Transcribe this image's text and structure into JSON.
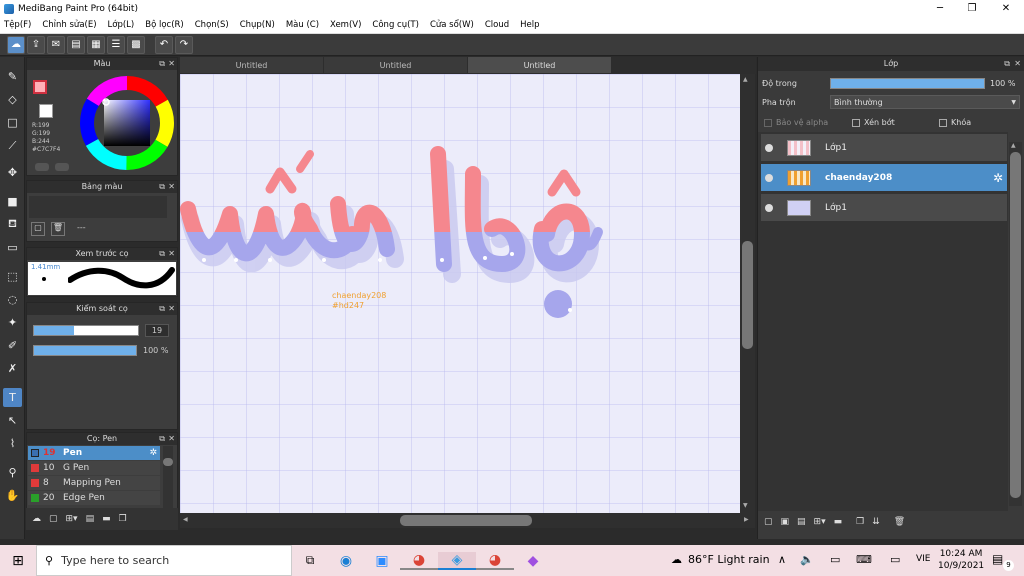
{
  "window": {
    "title": "MediBang Paint Pro (64bit)"
  },
  "menu": [
    "Tệp(F)",
    "Chỉnh sửa(E)",
    "Lớp(L)",
    "Bộ lọc(R)",
    "Chọn(S)",
    "Chụp(N)",
    "Màu (C)",
    "Xem(V)",
    "Công cụ(T)",
    "Cửa sổ(W)",
    "Cloud",
    "Help"
  ],
  "color_panel": {
    "title": "Màu",
    "r": "R:199",
    "g": "G:199",
    "b": "B:244",
    "hex": "#C7C7F4",
    "primary": "#ffb0b8",
    "secondary": "#ffffff"
  },
  "swatch_panel": {
    "title": "Bảng màu",
    "placeholder": "---"
  },
  "brush_preview": {
    "title": "Xem trước cọ",
    "size": "1.41mm"
  },
  "brush_control": {
    "title": "Kiểm soát cọ",
    "size_value": "19",
    "opacity_value": "100 %"
  },
  "brush_list": {
    "title": "Cọ: Pen",
    "items": [
      {
        "size": "19",
        "name": "Pen",
        "color": "#3a6fb0"
      },
      {
        "size": "10",
        "name": "G Pen",
        "color": "#e03a3a"
      },
      {
        "size": "8",
        "name": "Mapping Pen",
        "color": "#e03a3a"
      },
      {
        "size": "20",
        "name": "Edge Pen",
        "color": "#2aa02a"
      }
    ]
  },
  "tabs": [
    "Untitled",
    "Untitled",
    "Untitled"
  ],
  "canvas": {
    "text1": "chaenday208",
    "text2": "#hd247"
  },
  "layers_panel": {
    "title": "Lớp",
    "opacity_label": "Độ trong",
    "opacity_value": "100 %",
    "blend_label": "Pha trộn",
    "blend_value": "Bình thường",
    "protect_alpha": "Bảo vệ alpha",
    "clipping": "Xén bớt",
    "lock": "Khóa",
    "layers": [
      {
        "name": "Lớp1"
      },
      {
        "name": "chaenday208"
      },
      {
        "name": "Lớp1"
      }
    ]
  },
  "taskbar": {
    "search_placeholder": "Type here to search",
    "weather": "86°F  Light rain",
    "lang": "VIE",
    "time": "10:24 AM",
    "date": "10/9/2021",
    "notif": "9"
  }
}
